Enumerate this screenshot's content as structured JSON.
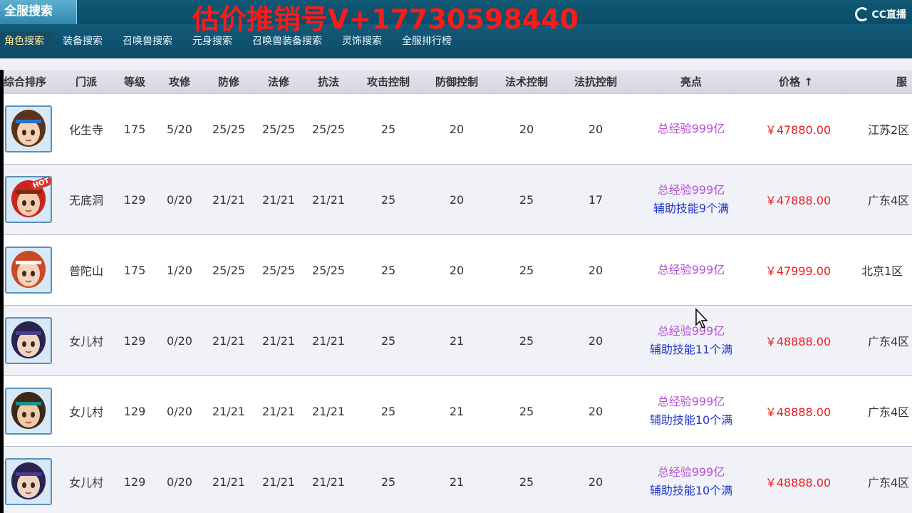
{
  "header": {
    "site_tab": "全服搜索",
    "overlay": "估价推销号V+17730598440",
    "logo_text": "CC直播"
  },
  "nav": [
    {
      "label": "角色搜索",
      "active": true
    },
    {
      "label": "装备搜索",
      "active": false
    },
    {
      "label": "召唤兽搜索",
      "active": false
    },
    {
      "label": "元身搜索",
      "active": false
    },
    {
      "label": "召唤兽装备搜索",
      "active": false
    },
    {
      "label": "灵饰搜索",
      "active": false
    },
    {
      "label": "全服排行榜",
      "active": false
    }
  ],
  "table": {
    "headers": {
      "sort": "综合排序",
      "school": "门派",
      "level": "等级",
      "attack_cultivation": "攻修",
      "defense_cultivation": "防修",
      "magic_cultivation": "法修",
      "magic_resist": "抗法",
      "attack_control": "攻击控制",
      "defense_control": "防御控制",
      "magic_control": "法术控制",
      "resist_control": "法抗控制",
      "highlight": "亮点",
      "price": "价格",
      "price_sort_icon": "↑",
      "server": "服"
    },
    "rows": [
      {
        "avatar": "boy-avatar-1",
        "hot": false,
        "school": "化生寺",
        "level": "175",
        "atk": "5/20",
        "def": "25/25",
        "mag": "25/25",
        "res": "25/25",
        "c1": "25",
        "c2": "20",
        "c3": "20",
        "c4": "20",
        "hl1": "总经验999亿",
        "hl2": "",
        "price": "￥47880.00",
        "server": "江苏2区"
      },
      {
        "avatar": "girl-red-hair-avatar",
        "hot": true,
        "hot_label": "HOT",
        "school": "无底洞",
        "level": "129",
        "atk": "0/20",
        "def": "21/21",
        "mag": "21/21",
        "res": "21/21",
        "c1": "25",
        "c2": "20",
        "c3": "25",
        "c4": "17",
        "hl1": "总经验999亿",
        "hl2": "辅助技能9个满",
        "price": "￥47888.00",
        "server": "广东4区"
      },
      {
        "avatar": "girl-red-hair-avatar-2",
        "hot": false,
        "school": "普陀山",
        "level": "175",
        "atk": "1/20",
        "def": "25/25",
        "mag": "25/25",
        "res": "25/25",
        "c1": "25",
        "c2": "20",
        "c3": "25",
        "c4": "20",
        "hl1": "总经验999亿",
        "hl2": "",
        "price": "￥47999.00",
        "server": "北京1区"
      },
      {
        "avatar": "girl-dark-hair-avatar",
        "hot": false,
        "school": "女儿村",
        "level": "129",
        "atk": "0/20",
        "def": "21/21",
        "mag": "21/21",
        "res": "21/21",
        "c1": "25",
        "c2": "21",
        "c3": "25",
        "c4": "20",
        "hl1": "总经验999亿",
        "hl2": "辅助技能11个满",
        "price": "￥48888.00",
        "server": "广东4区"
      },
      {
        "avatar": "boy-avatar-2",
        "hot": false,
        "school": "女儿村",
        "level": "129",
        "atk": "0/20",
        "def": "21/21",
        "mag": "21/21",
        "res": "21/21",
        "c1": "25",
        "c2": "21",
        "c3": "25",
        "c4": "20",
        "hl1": "总经验999亿",
        "hl2": "辅助技能10个满",
        "price": "￥48888.00",
        "server": "广东4区"
      },
      {
        "avatar": "girl-dark-hair-avatar-2",
        "hot": false,
        "school": "女儿村",
        "level": "129",
        "atk": "0/20",
        "def": "21/21",
        "mag": "21/21",
        "res": "21/21",
        "c1": "25",
        "c2": "21",
        "c3": "25",
        "c4": "20",
        "hl1": "总经验999亿",
        "hl2": "辅助技能10个满",
        "price": "￥48888.00",
        "server": "广东4区"
      }
    ]
  },
  "colors": {
    "header_bg": "#0d4a66",
    "overlay_text": "#ff1a1a",
    "price": "#ea1e1e",
    "highlight_exp": "#b84fd8",
    "highlight_skill": "#2236c9"
  }
}
